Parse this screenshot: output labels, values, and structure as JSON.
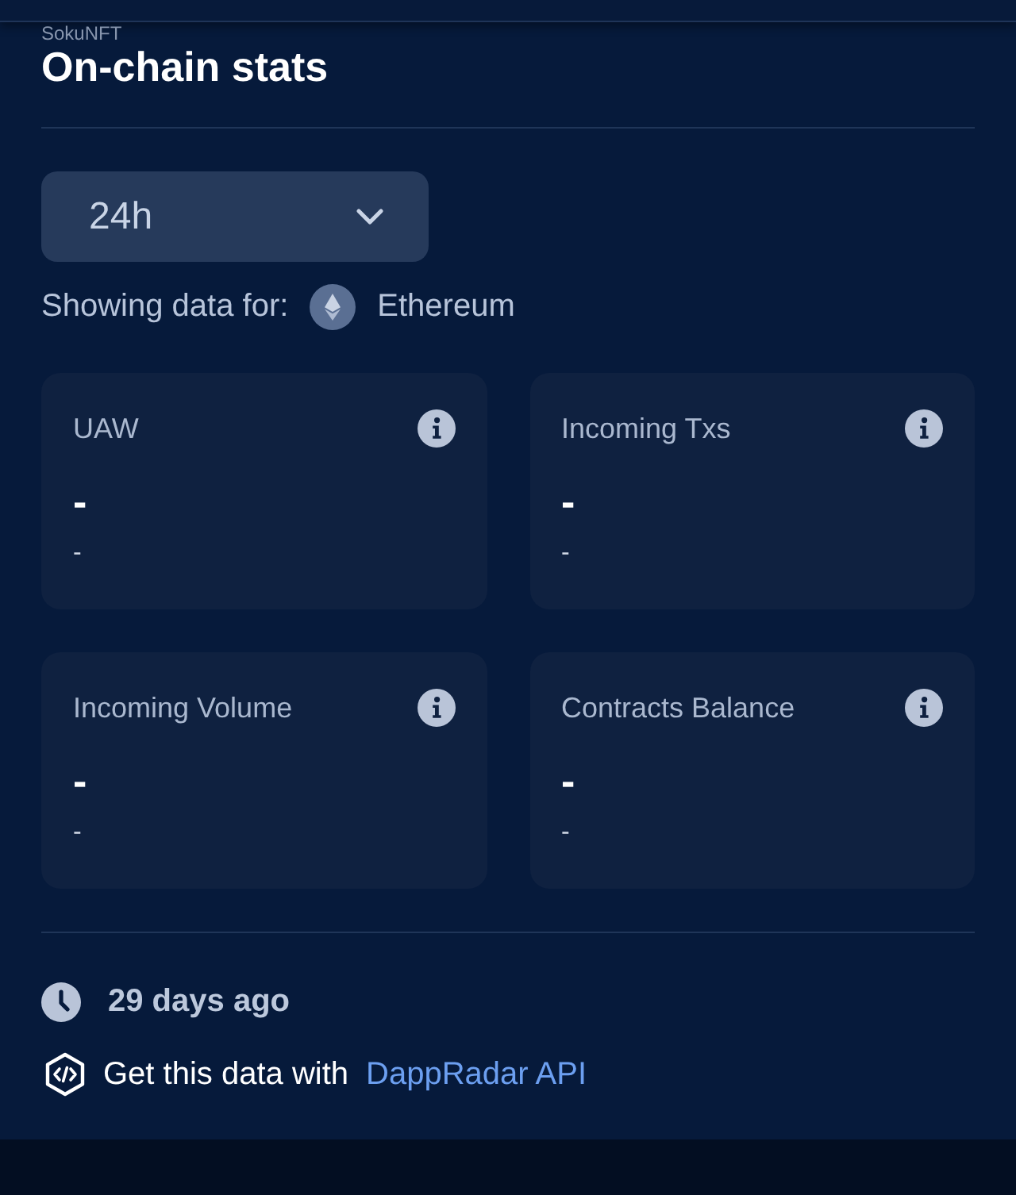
{
  "header": {
    "subtitle": "SokuNFT",
    "title": "On-chain stats"
  },
  "period_select": {
    "value": "24h"
  },
  "network": {
    "label": "Showing data for:",
    "name": "Ethereum"
  },
  "stats": [
    {
      "label": "UAW",
      "value": "-",
      "change": "-"
    },
    {
      "label": "Incoming Txs",
      "value": "-",
      "change": "-"
    },
    {
      "label": "Incoming Volume",
      "value": "-",
      "change": "-"
    },
    {
      "label": "Contracts Balance",
      "value": "-",
      "change": "-"
    }
  ],
  "updated": {
    "text": "29 days ago"
  },
  "api": {
    "text": "Get this data with",
    "link": "DappRadar API"
  }
}
